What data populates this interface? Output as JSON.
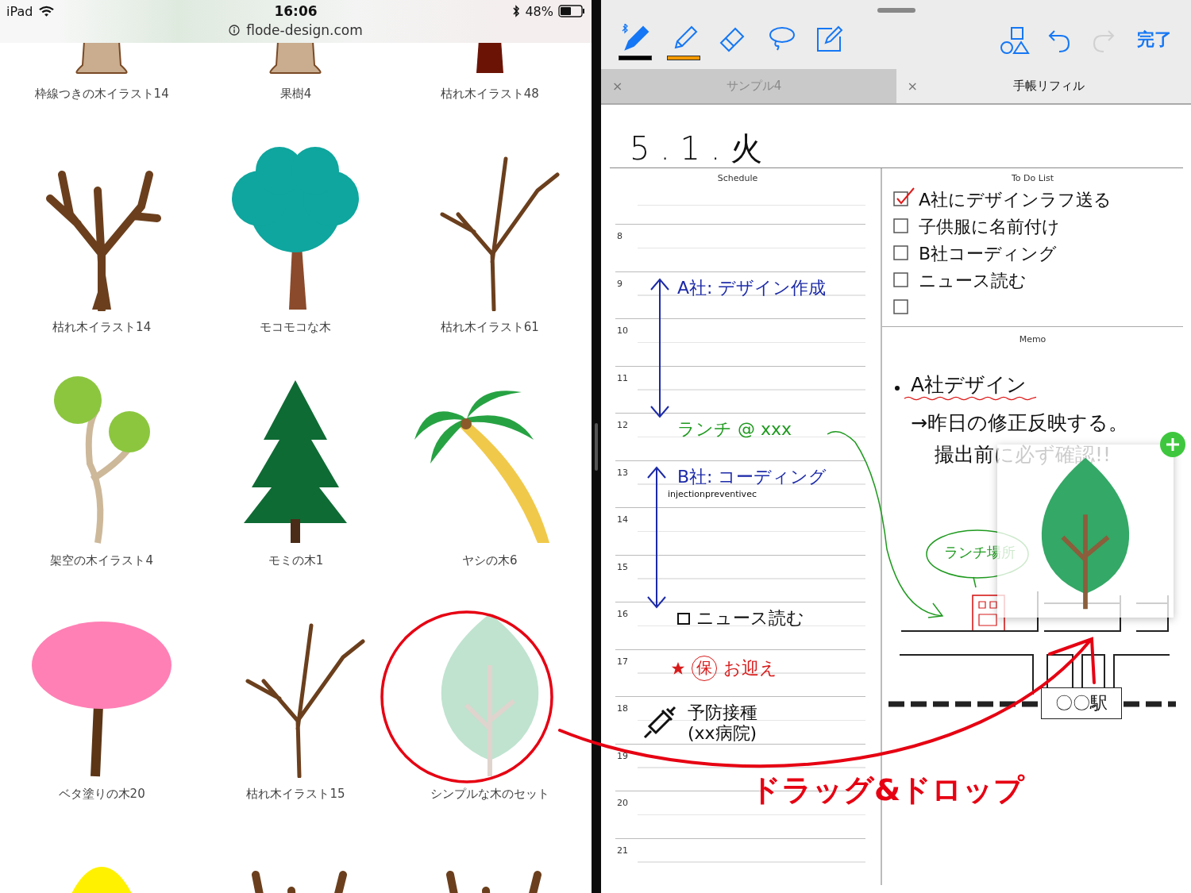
{
  "status_bar": {
    "device": "iPad",
    "time": "16:06",
    "url": "flode-design.com",
    "battery": "48%"
  },
  "gallery": [
    {
      "kind": "stump",
      "caption": "枠線つきの木イラスト14"
    },
    {
      "kind": "stump",
      "caption": "果樹4"
    },
    {
      "kind": "darkstump",
      "caption": "枯れ木イラスト48"
    },
    {
      "kind": "bare",
      "caption": "枯れ木イラスト14"
    },
    {
      "kind": "cloud",
      "caption": "モコモコな木"
    },
    {
      "kind": "twig",
      "caption": "枯れ木イラスト61"
    },
    {
      "kind": "balls",
      "caption": "架空の木イラスト4"
    },
    {
      "kind": "fir",
      "caption": "モミの木1"
    },
    {
      "kind": "palm",
      "caption": "ヤシの木6"
    },
    {
      "kind": "blossom",
      "caption": "ベタ塗りの木20"
    },
    {
      "kind": "twig",
      "caption": "枯れ木イラスト15"
    },
    {
      "kind": "leaf",
      "caption": "シンプルな木のセット"
    },
    {
      "kind": "yellowtop"
    },
    {
      "kind": "bare"
    },
    {
      "kind": "bare"
    }
  ],
  "annotation": {
    "label": "ドラッグ&ドロップ"
  },
  "toolbar": {
    "tools": [
      {
        "kind": "pen",
        "color": "#000000",
        "selected": true
      },
      {
        "kind": "highlighter",
        "color": "#f39800",
        "selected": false
      },
      {
        "kind": "eraser",
        "selected": false
      },
      {
        "kind": "lasso",
        "selected": false
      },
      {
        "kind": "compose",
        "selected": false
      }
    ],
    "undo": {
      "disabled": false
    },
    "redo": {
      "disabled": true
    },
    "done": "完了"
  },
  "tabs": [
    {
      "label": "サンプル4",
      "close": "×",
      "selected": false
    },
    {
      "label": "手帳リフィル",
      "close": "×",
      "selected": true
    }
  ],
  "notebook": {
    "date": "5 . 1 . 火",
    "schedule": {
      "title": "Schedule",
      "hours": [
        {
          "label": "8"
        },
        {
          "label": "9",
          "entries": [
            {
              "kind": "note",
              "text": "A社: デザイン作成",
              "color": "#1c2aa8"
            }
          ]
        },
        {
          "label": "10"
        },
        {
          "label": "11"
        },
        {
          "label": "12",
          "entries": [
            {
              "kind": "note",
              "text": "ランチ @ xxx",
              "color": "#1f9a1f"
            }
          ]
        },
        {
          "label": "13",
          "entries": [
            {
              "kind": "note",
              "text": "B社: コーディング",
              "color": "#1c2aa8"
            },
            {
              "kind": "small",
              "text": "injectionpreventivec",
              "color": "#111111"
            }
          ]
        },
        {
          "label": "14"
        },
        {
          "label": "15"
        },
        {
          "label": "16",
          "entries": [
            {
              "kind": "box",
              "text": "ニュース読む",
              "color": "#111111"
            }
          ]
        },
        {
          "label": "17",
          "entries": [
            {
              "kind": "star",
              "circled": "保",
              "text": "お迎え",
              "color": "#d81b1b"
            }
          ]
        },
        {
          "label": "18",
          "entries": [
            {
              "kind": "vaccine",
              "lines": [
                "予防接種",
                "(xx病院)"
              ],
              "color": "#111111"
            }
          ]
        },
        {
          "label": "19"
        },
        {
          "label": "20"
        },
        {
          "label": "21"
        }
      ]
    },
    "todo": {
      "title": "To Do List",
      "items": [
        {
          "text": "A社にデザインラフ送る",
          "checked": true
        },
        {
          "text": "子供服に名前付け",
          "checked": false
        },
        {
          "text": "B社コーディング",
          "checked": false
        },
        {
          "text": "ニュース読む",
          "checked": false
        },
        {
          "checked": false
        }
      ]
    },
    "memo": {
      "title": "Memo",
      "lines": [
        {
          "kind": "bullet",
          "text": "A社デザイン"
        },
        {
          "kind": "plain",
          "text": "→昨日の修正反映する。"
        },
        {
          "kind": "plain",
          "text": "撮出前に必ず確認!!"
        }
      ],
      "bubble": "ランチ場所",
      "station": "〇〇駅"
    }
  }
}
